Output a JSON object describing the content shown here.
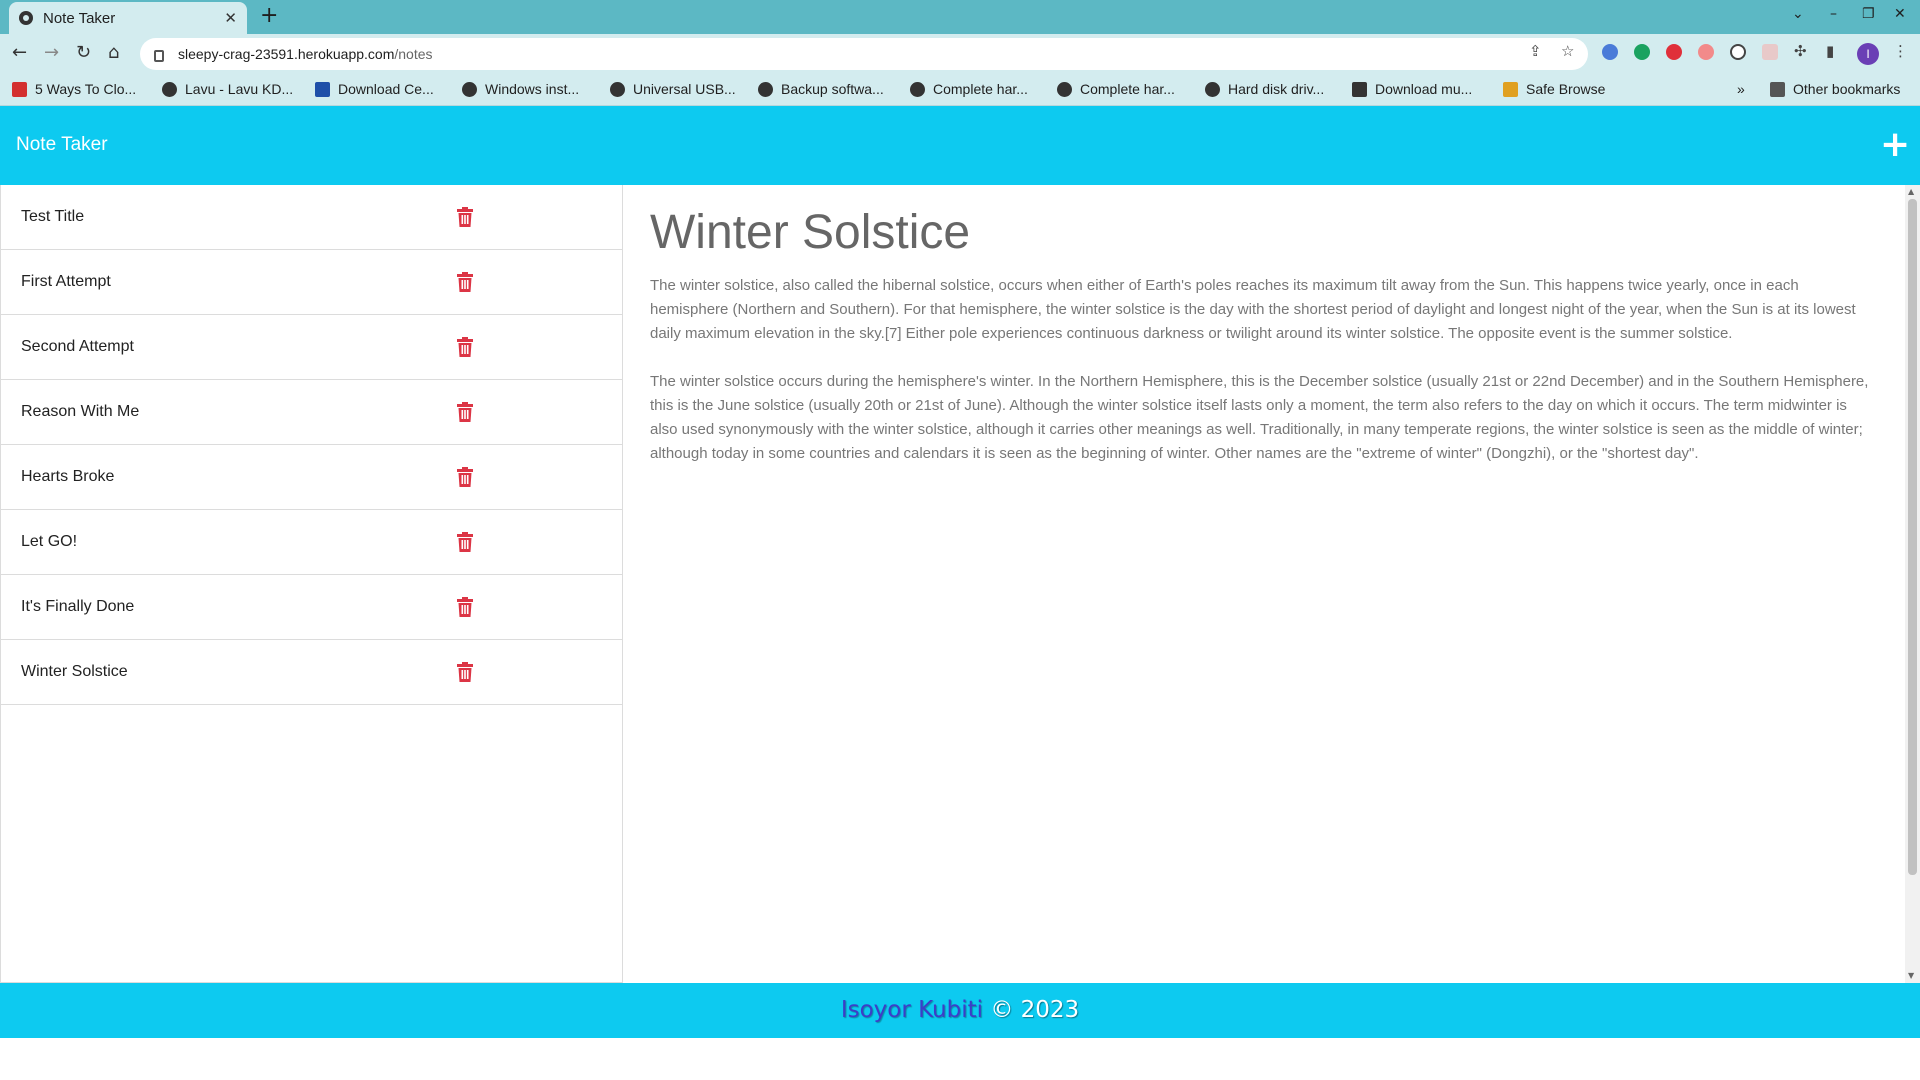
{
  "browser": {
    "tab_title": "Note Taker",
    "url_host": "sleepy-crag-23591.herokuapp.com",
    "url_path": "/notes",
    "bookmarks": [
      {
        "label": "5 Ways To Clo...",
        "color": "#d32f2f"
      },
      {
        "label": "Lavu - Lavu KD...",
        "color": "#333333"
      },
      {
        "label": "Download Ce...",
        "color": "#1e4fa8"
      },
      {
        "label": "Windows inst...",
        "color": "#333333"
      },
      {
        "label": "Universal USB...",
        "color": "#333333"
      },
      {
        "label": "Backup softwa...",
        "color": "#333333"
      },
      {
        "label": "Complete har...",
        "color": "#333333"
      },
      {
        "label": "Complete har...",
        "color": "#333333"
      },
      {
        "label": "Hard disk driv...",
        "color": "#333333"
      },
      {
        "label": "Download mu...",
        "color": "#333333"
      },
      {
        "label": "Safe Browse",
        "color": "#e0a020"
      }
    ],
    "other_bookmarks": "Other bookmarks"
  },
  "app": {
    "brand": "Note Taker",
    "colors": {
      "header": "#0dcaf0",
      "trash": "#dc3545"
    }
  },
  "notes": [
    {
      "title": "Test Title"
    },
    {
      "title": "First Attempt"
    },
    {
      "title": "Second Attempt"
    },
    {
      "title": "Reason With Me"
    },
    {
      "title": "Hearts Broke"
    },
    {
      "title": "Let GO!"
    },
    {
      "title": "It's Finally Done"
    },
    {
      "title": "Winter Solstice"
    }
  ],
  "active_note": {
    "title": "Winter Solstice",
    "paragraphs": [
      "The winter solstice, also called the hibernal solstice, occurs when either of Earth's poles reaches its maximum tilt away from the Sun. This happens twice yearly, once in each hemisphere (Northern and Southern). For that hemisphere, the winter solstice is the day with the shortest period of daylight and longest night of the year, when the Sun is at its lowest daily maximum elevation in the sky.[7] Either pole experiences continuous darkness or twilight around its winter solstice. The opposite event is the summer solstice.",
      "The winter solstice occurs during the hemisphere's winter. In the Northern Hemisphere, this is the December solstice (usually 21st or 22nd December) and in the Southern Hemisphere, this is the June solstice (usually 20th or 21st of June). Although the winter solstice itself lasts only a moment, the term also refers to the day on which it occurs. The term midwinter is also used synonymously with the winter solstice, although it carries other meanings as well. Traditionally, in many temperate regions, the winter solstice is seen as the middle of winter; although today in some countries and calendars it is seen as the beginning of winter. Other names are the \"extreme of winter\" (Dongzhi), or the \"shortest day\"."
    ]
  },
  "footer": {
    "author": "Isoyor Kubiti",
    "copyright": " © 2023"
  }
}
